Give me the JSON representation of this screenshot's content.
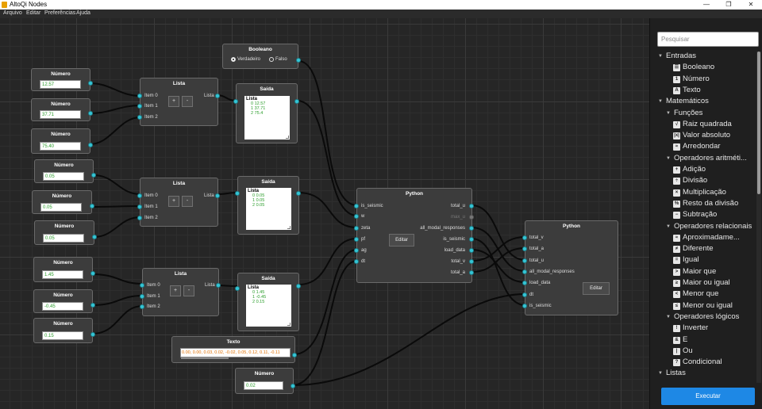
{
  "app": {
    "title": "AltoQi Nodes",
    "min": "—",
    "max": "❐",
    "close": "✕"
  },
  "menu": [
    "Arquivo",
    "Editar",
    "Preferências",
    "Ajuda"
  ],
  "nodes": {
    "numeros": [
      {
        "title": "Número",
        "value": "12.57"
      },
      {
        "title": "Número",
        "value": "37.71"
      },
      {
        "title": "Número",
        "value": "75.40"
      },
      {
        "title": "Número",
        "value": "0.05"
      },
      {
        "title": "Número",
        "value": "0.05"
      },
      {
        "title": "Número",
        "value": "0.05"
      },
      {
        "title": "Número",
        "value": "1.45"
      },
      {
        "title": "Número",
        "value": "-0.45"
      },
      {
        "title": "Número",
        "value": "0.15"
      },
      {
        "title": "Número",
        "value": "0.02"
      }
    ],
    "listas": [
      {
        "title": "Lista",
        "items": [
          "Item 0",
          "Item 1",
          "Item 2"
        ],
        "out": "Lista",
        "add": "+",
        "remove": "-"
      },
      {
        "title": "Lista",
        "items": [
          "Item 0",
          "Item 1",
          "Item 2"
        ],
        "out": "Lista",
        "add": "+",
        "remove": "-"
      },
      {
        "title": "Lista",
        "items": [
          "Item 0",
          "Item 1",
          "Item 2"
        ],
        "out": "Lista",
        "add": "+",
        "remove": "-"
      }
    ],
    "saidas": [
      {
        "title": "Saída",
        "header": "Lista",
        "lines": [
          "0 12.57",
          "1 37.71",
          "2 75.4"
        ]
      },
      {
        "title": "Saída",
        "header": "Lista",
        "lines": [
          "0 0.05",
          "1 0.05",
          "2 0.05"
        ]
      },
      {
        "title": "Saída",
        "header": "Lista",
        "lines": [
          "0 1.45",
          "1 -0.45",
          "2 0.15"
        ]
      }
    ],
    "booleano": {
      "title": "Booleano",
      "opt_true": "Verdadeiro",
      "opt_false": "Falso",
      "selected": "Verdadeiro"
    },
    "texto": {
      "title": "Texto",
      "value": "0.00, 0.00, 0.03, 0.02, -0.02, 0.05, 0.12, 0.11, -0.11"
    },
    "python1": {
      "title": "Python",
      "inputs": [
        "is_seismic",
        "w",
        "zeta",
        "pf",
        "ag",
        "dt"
      ],
      "outputs": [
        "total_u",
        "max_u",
        "all_modal_responses",
        "is_seismic",
        "load_data",
        "total_v",
        "total_a"
      ],
      "edit": "Editar"
    },
    "python2": {
      "title": "Python",
      "inputs": [
        "total_v",
        "total_a",
        "total_u",
        "all_modal_responses",
        "load_data",
        "dt",
        "is_seismic"
      ],
      "edit": "Editar"
    }
  },
  "sidebar": {
    "search_placeholder": "Pesquisar",
    "tree": [
      {
        "level": 0,
        "arrow": "▼",
        "label": "Entradas"
      },
      {
        "level": 2,
        "icon": "☰",
        "label": "Booleano"
      },
      {
        "level": 2,
        "icon": "1",
        "label": "Número"
      },
      {
        "level": 2,
        "icon": "A",
        "label": "Texto"
      },
      {
        "level": 0,
        "arrow": "▼",
        "label": "Matemáticos"
      },
      {
        "level": 1,
        "arrow": "▼",
        "label": "Funções"
      },
      {
        "level": 2,
        "icon": "√",
        "label": "Raiz quadrada"
      },
      {
        "level": 2,
        "icon": "|x|",
        "label": "Valor absoluto"
      },
      {
        "level": 2,
        "icon": "≈",
        "label": "Arredondar"
      },
      {
        "level": 1,
        "arrow": "▼",
        "label": "Operadores aritméti..."
      },
      {
        "level": 2,
        "icon": "+",
        "label": "Adição"
      },
      {
        "level": 2,
        "icon": "÷",
        "label": "Divisão"
      },
      {
        "level": 2,
        "icon": "×",
        "label": "Multiplicação"
      },
      {
        "level": 2,
        "icon": "%",
        "label": "Resto da divisão"
      },
      {
        "level": 2,
        "icon": "−",
        "label": "Subtração"
      },
      {
        "level": 1,
        "arrow": "▼",
        "label": "Operadores relacionais"
      },
      {
        "level": 2,
        "icon": "≈",
        "label": "Aproximadame..."
      },
      {
        "level": 2,
        "icon": "≠",
        "label": "Diferente"
      },
      {
        "level": 2,
        "icon": "=",
        "label": "Igual"
      },
      {
        "level": 2,
        "icon": ">",
        "label": "Maior que"
      },
      {
        "level": 2,
        "icon": "≥",
        "label": "Maior ou igual"
      },
      {
        "level": 2,
        "icon": "<",
        "label": "Menor que"
      },
      {
        "level": 2,
        "icon": "≤",
        "label": "Menor ou igual"
      },
      {
        "level": 1,
        "arrow": "▼",
        "label": "Operadores lógicos"
      },
      {
        "level": 2,
        "icon": "!",
        "label": "Inverter"
      },
      {
        "level": 2,
        "icon": "&",
        "label": "E"
      },
      {
        "level": 2,
        "icon": "|",
        "label": "Ou"
      },
      {
        "level": 2,
        "icon": "?",
        "label": "Condicional"
      },
      {
        "level": 0,
        "arrow": "▼",
        "label": "Listas"
      }
    ],
    "run_label": "Executar"
  },
  "colors": {
    "port": "#35c6d6",
    "accent": "#1e88e5",
    "value_green": "#2a9d2a",
    "text_orange": "#e07000"
  }
}
